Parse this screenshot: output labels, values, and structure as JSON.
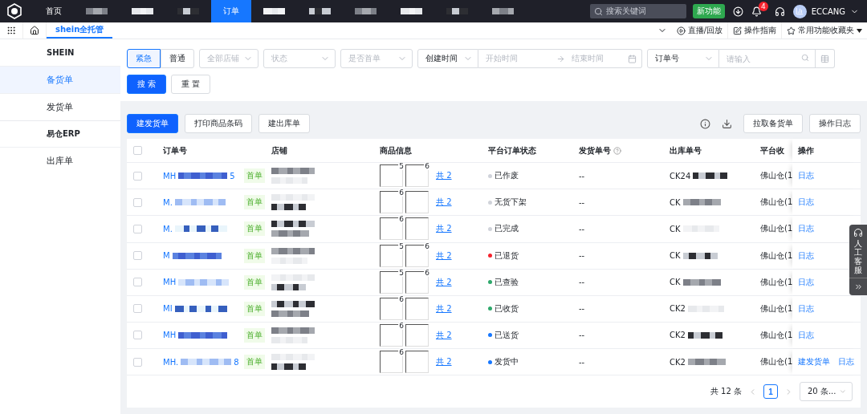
{
  "topbar": {
    "nav": [
      {
        "kind": "text",
        "label": "首页",
        "selected": false
      },
      {
        "kind": "masked"
      },
      {
        "kind": "masked"
      },
      {
        "kind": "masked"
      },
      {
        "kind": "text",
        "label": "订单",
        "selected": true
      },
      {
        "kind": "masked"
      },
      {
        "kind": "masked"
      },
      {
        "kind": "masked"
      },
      {
        "kind": "masked"
      },
      {
        "kind": "masked"
      },
      {
        "kind": "masked"
      }
    ],
    "search": {
      "placeholder": "搜索关键词"
    },
    "new_feature": "新功能",
    "notifications": "4",
    "user": "ECCANG"
  },
  "tabbar": {
    "tabs": [
      {
        "label": "shein全托管",
        "selected": true
      }
    ],
    "links": [
      "直播/回放",
      "操作指南",
      "常用功能收藏夹"
    ]
  },
  "sidebar": {
    "groups": [
      {
        "title": "SHEIN",
        "items": [
          {
            "label": "备货单",
            "selected": true
          },
          {
            "label": "发货单",
            "selected": false
          }
        ]
      },
      {
        "title": "易仓ERP",
        "items": [
          {
            "label": "出库单",
            "selected": false
          }
        ]
      }
    ]
  },
  "filters": {
    "priority": [
      {
        "label": "紧急",
        "selected": true
      },
      {
        "label": "普通",
        "selected": false
      }
    ],
    "selects": [
      {
        "placeholder": "全部店铺"
      },
      {
        "placeholder": "状态"
      },
      {
        "placeholder": "是否首单"
      }
    ],
    "time_type": "创建时间",
    "start": {
      "placeholder": "开始时间"
    },
    "end": {
      "placeholder": "结束时间"
    },
    "field_type": "订单号",
    "keyword": {
      "placeholder": "请输入"
    },
    "search_button": "搜 索",
    "reset_button": "重 置"
  },
  "actions": {
    "left": [
      "建发货单",
      "打印商品条码",
      "建出库单"
    ],
    "right": [
      "拉取备货单",
      "操作日志"
    ]
  },
  "table": {
    "all_checked": false,
    "columns": [
      "订单号",
      "店铺",
      "商品信息",
      "平台订单状态",
      "发货单号",
      "出库单号",
      "平台收",
      "操作"
    ],
    "rows": [
      {
        "checked": false,
        "order_start": "MH",
        "order_end": "5",
        "tag": "首单",
        "badges": [
          "5",
          "6"
        ],
        "count": "共 2",
        "status": "已作废",
        "color": "#d0d3da",
        "ship": "--",
        "outbound": "CK24",
        "warehouse": "佛山仓(1",
        "ops": [
          "日志"
        ]
      },
      {
        "checked": false,
        "order_start": "M.",
        "tag": "首单",
        "badges": [
          "6"
        ],
        "count": "共 2",
        "status": "无货下架",
        "color": "#d0d3da",
        "ship": "--",
        "outbound": "CK",
        "warehouse": "佛山仓(1",
        "ops": [
          "日志"
        ]
      },
      {
        "checked": false,
        "order_start": "M.",
        "tag": "首单",
        "badges": [
          "6"
        ],
        "count": "共 2",
        "status": "已完成",
        "color": "#d0d3da",
        "ship": "--",
        "outbound": "CK",
        "warehouse": "佛山仓(1",
        "ops": [
          "日志"
        ]
      },
      {
        "checked": false,
        "order_start": "M",
        "tag": "首单",
        "badges": [
          "5",
          "6"
        ],
        "count": "共 2",
        "status": "已退货",
        "color": "#f5222d",
        "ship": "--",
        "outbound": "CK",
        "warehouse": "佛山仓(1",
        "ops": [
          "日志"
        ]
      },
      {
        "checked": false,
        "order_start": "MH",
        "tag": "首单",
        "badges": [
          "5",
          "6"
        ],
        "count": "共 2",
        "status": "已查验",
        "color": "#2ea86b",
        "ship": "--",
        "outbound": "CK",
        "warehouse": "佛山仓(1",
        "ops": [
          "日志"
        ]
      },
      {
        "checked": false,
        "order_start": "MI",
        "tag": "首单",
        "badges": [
          "6"
        ],
        "count": "共 2",
        "status": "已收货",
        "color": "#2ea86b",
        "ship": "--",
        "outbound": "CK2",
        "warehouse": "佛山仓(1",
        "ops": [
          "日志"
        ]
      },
      {
        "checked": false,
        "order_start": "MH",
        "tag": "首单",
        "badges": [
          "6"
        ],
        "count": "共 2",
        "status": "已送货",
        "color": "#1677ff",
        "ship": "--",
        "outbound": "CK2",
        "warehouse": "佛山仓(1",
        "ops": [
          "日志"
        ]
      },
      {
        "checked": false,
        "order_start": "MH.",
        "order_end": "8",
        "tag": "首单",
        "badges": [
          "6"
        ],
        "count": "共 2",
        "status": "发货中",
        "color": "#1677ff",
        "ship": "--",
        "outbound": "CK2",
        "warehouse": "佛山仓(1",
        "ops": [
          "建发货单",
          "日志"
        ]
      }
    ]
  },
  "pagination": {
    "total": "共 12 条",
    "pages": [
      {
        "label": "1",
        "selected": true
      }
    ],
    "page_size": "20 条..."
  },
  "support": {
    "label": "人工客服"
  }
}
